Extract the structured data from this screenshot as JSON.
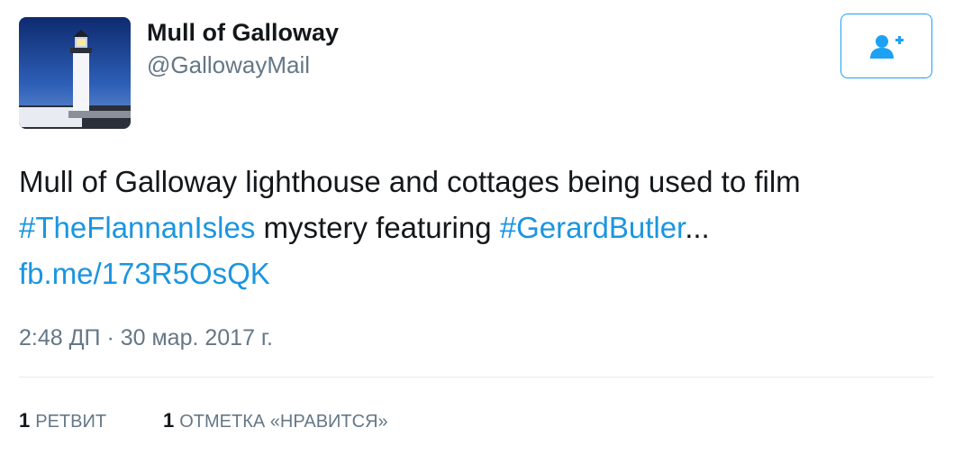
{
  "user": {
    "display_name": "Mull of Galloway",
    "handle": "@GallowayMail",
    "avatar_icon": "lighthouse-photo"
  },
  "follow_button": {
    "icon": "add-user-icon",
    "color": "#1da1f2"
  },
  "tweet": {
    "text_line1": "Mull of Galloway lighthouse and cottages being used to film",
    "hashtag1": "#TheFlannanIsles",
    "text_middle": " mystery featuring ",
    "hashtag2": "#GerardButler",
    "ellipsis": "...",
    "link": "fb.me/173R5OsQK",
    "link_color": "#1b95e0"
  },
  "timestamp": "2:48 ДП · 30 мар. 2017 г.",
  "stats": {
    "retweets_count": "1",
    "retweets_label": "РЕТВИТ",
    "likes_count": "1",
    "likes_label": "ОТМЕТКА «НРАВИТСЯ»"
  }
}
